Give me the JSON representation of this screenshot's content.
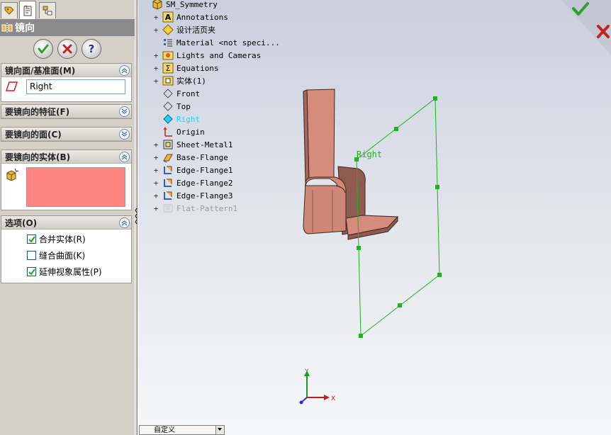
{
  "property_manager": {
    "tabs": [
      "feature-manager-tab",
      "property-manager-tab",
      "configuration-manager-tab"
    ],
    "title": "镜向",
    "buttons": {
      "ok": "ok-button",
      "cancel": "cancel-button",
      "help": "help-button"
    },
    "mirror_face_group": {
      "title": "镜向面/基准面(M)",
      "value": "Right"
    },
    "features_group": {
      "title": "要镜向的特征(F)"
    },
    "faces_group": {
      "title": "要镜向的面(C)"
    },
    "bodies_group": {
      "title": "要镜向的实体(B)"
    },
    "options_group": {
      "title": "选项(O)",
      "options": [
        {
          "label": "合并实体(R)",
          "checked": true
        },
        {
          "label": "缝合曲面(K)",
          "checked": false
        },
        {
          "label": "延伸视象属性(P)",
          "checked": true
        }
      ]
    }
  },
  "feature_tree": {
    "root": "SM_Symmetry",
    "items": [
      {
        "label": "Annotations",
        "icon": "annotations-icon",
        "expandable": true,
        "state": "normal"
      },
      {
        "label": "设计活页夹",
        "icon": "design-binder-icon",
        "expandable": true,
        "state": "normal"
      },
      {
        "label": "Material <not speci...",
        "icon": "material-icon",
        "expandable": false,
        "state": "normal"
      },
      {
        "label": "Lights and Cameras",
        "icon": "lights-icon",
        "expandable": true,
        "state": "normal"
      },
      {
        "label": "Equations",
        "icon": "equations-icon",
        "expandable": true,
        "state": "normal"
      },
      {
        "label": "实体(1)",
        "icon": "solid-bodies-icon",
        "expandable": true,
        "state": "normal"
      },
      {
        "label": "Front",
        "icon": "plane-icon",
        "expandable": false,
        "state": "normal"
      },
      {
        "label": "Top",
        "icon": "plane-icon",
        "expandable": false,
        "state": "normal"
      },
      {
        "label": "Right",
        "icon": "plane-icon",
        "expandable": false,
        "state": "selected"
      },
      {
        "label": "Origin",
        "icon": "origin-icon",
        "expandable": false,
        "state": "normal"
      },
      {
        "label": "Sheet-Metal1",
        "icon": "sheet-metal-icon",
        "expandable": true,
        "state": "normal"
      },
      {
        "label": "Base-Flange",
        "icon": "base-flange-icon",
        "expandable": true,
        "state": "normal"
      },
      {
        "label": "Edge-Flange1",
        "icon": "edge-flange-icon",
        "expandable": true,
        "state": "normal"
      },
      {
        "label": "Edge-Flange2",
        "icon": "edge-flange-icon",
        "expandable": true,
        "state": "normal"
      },
      {
        "label": "Edge-Flange3",
        "icon": "edge-flange-icon",
        "expandable": true,
        "state": "normal"
      },
      {
        "label": "Flat-Pattern1",
        "icon": "flat-pattern-icon",
        "expandable": true,
        "state": "suppressed"
      }
    ]
  },
  "viewport": {
    "plane_label": "Right",
    "triad": {
      "x": "X",
      "y": "Y"
    },
    "view_dropdown": "自定义"
  },
  "colors": {
    "plane": "#1db31d",
    "body": "#d2877a",
    "selection": "#22d4ee",
    "ok_green": "#2e9e2e",
    "cancel_red": "#c52020"
  }
}
